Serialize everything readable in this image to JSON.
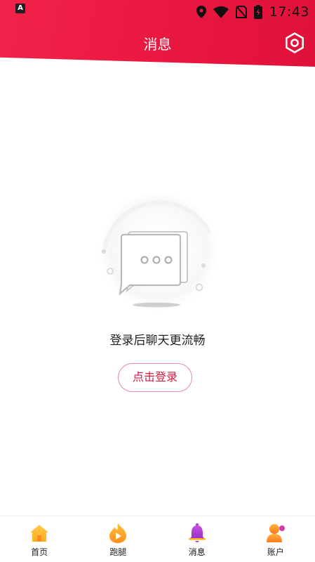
{
  "status_bar": {
    "app_badge": "A",
    "time": "17:43"
  },
  "header": {
    "title": "消息"
  },
  "empty_state": {
    "message": "登录后聊天更流畅",
    "login_button": "点击登录"
  },
  "bottom_nav": {
    "items": [
      {
        "label": "首页",
        "icon": "home-icon"
      },
      {
        "label": "跑腿",
        "icon": "errand-icon"
      },
      {
        "label": "消息",
        "icon": "bell-icon",
        "active": true
      },
      {
        "label": "账户",
        "icon": "account-icon"
      }
    ]
  },
  "colors": {
    "header_red": "#e8173f",
    "accent": "#d8183f",
    "button_border": "#e78a99"
  }
}
